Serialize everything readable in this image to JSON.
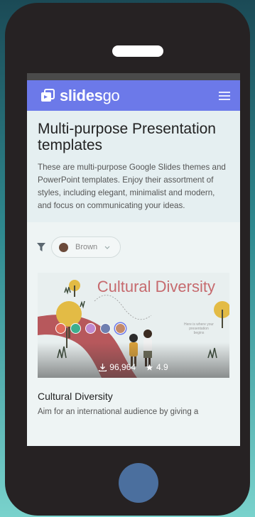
{
  "brand": {
    "name_bold": "slides",
    "name_light": "go"
  },
  "hero": {
    "title": "Multi-purpose Presentation templates",
    "description": "These are multi-purpose Google Slides themes and PowerPoint templates. Enjoy their assortment of styles, including elegant, minimalist and modern, and focus on communicating your ideas."
  },
  "filters": {
    "color_label": "Brown",
    "color_value": "#6b4a3a"
  },
  "template": {
    "thumb_title": "Cultural Diversity",
    "thumb_tagline": "Here is where your presentation begins",
    "downloads": "96,964",
    "rating": "4.9",
    "swatches": [
      "#e06a5a",
      "#3fae8e",
      "#c08ad0",
      "#6f7fb0",
      "#c48a6a"
    ],
    "title": "Cultural Diversity",
    "description": "Aim for an international audience by giving a"
  },
  "icons": {
    "logo": "slides-icon",
    "menu": "hamburger-icon",
    "filter": "funnel-icon",
    "download": "download-icon",
    "rating": "star-icon"
  }
}
